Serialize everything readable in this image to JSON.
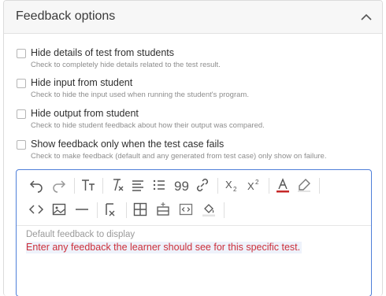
{
  "panel": {
    "title": "Feedback options"
  },
  "options": [
    {
      "label": "Hide details of test from students",
      "description": "Check to completely hide details related to the test result.",
      "checked": false
    },
    {
      "label": "Hide input from student",
      "description": "Check to hide the input used when running the student's program.",
      "checked": false
    },
    {
      "label": "Hide output from student",
      "description": "Check to hide student feedback about how their output was compared.",
      "checked": false
    },
    {
      "label": "Show feedback only when the test case fails",
      "description": "Check to make feedback (default and any generated from test case) only show on failure.",
      "checked": false
    }
  ],
  "editor": {
    "placeholder_label": "Default feedback to display",
    "content": "Enter any feedback the learner should see for this specific test.",
    "toolbar_row1": [
      "undo-icon",
      "redo-icon",
      "font-size-icon",
      "clear-format-icon",
      "align-icon",
      "bulleted-list-icon",
      "quote-icon",
      "link-icon",
      "subscript-icon",
      "superscript-icon",
      "font-color-icon",
      "highlight-icon"
    ],
    "toolbar_row2": [
      "code-icon",
      "image-icon",
      "horizontal-rule-icon",
      "math-formula-icon",
      "table-icon",
      "insert-row-icon",
      "embed-code-icon",
      "fill-color-icon"
    ]
  },
  "colors": {
    "accent_border": "#4f7fd9",
    "font_color_swatch": "#c62828",
    "content_text": "#cc2f3a"
  }
}
